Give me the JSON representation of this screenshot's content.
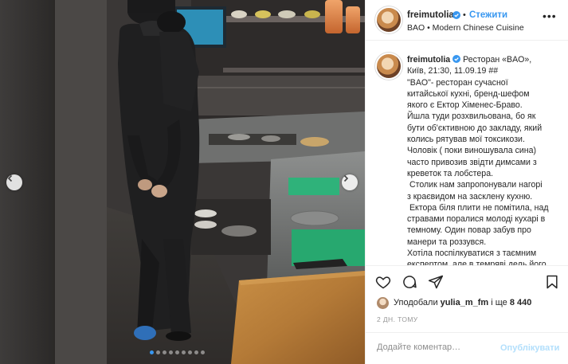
{
  "post": {
    "username": "freimutolia",
    "follow_label": "Стежити",
    "separator": "•",
    "location": "BAO • Modern Chinese Cuisine",
    "more_label": "•••"
  },
  "caption": {
    "username": "freimutolia",
    "lines": [
      "Ресторан «BAO»,",
      "Київ, 21:30, 11.09.19 ##",
      "\"BAO\"- ресторан сучасної",
      "китайської кухні, бренд-шефом",
      "якого є Ектор Хіменес-Браво.",
      "Йшла туди розхвильована, бо як",
      "бути об'єктивною до закладу, який",
      "колись рятував мої токсикози.",
      "Чоловік ( поки виношувала сина)",
      "часто привозив звідти димсами з",
      "креветок та лобстера.",
      " Столик нам запропонували нагорі",
      "з краєвидом на засклену кухню.",
      " Ектора біля плити не помітила, над",
      "стравами поралися молоді кухарі в",
      "темному. Один повар забув про",
      "манери та роззувся.",
      "Хотіла поспілкуватися з таємним",
      "експертом, але в темряві дедь його"
    ]
  },
  "likes": {
    "prefix": "Уподобали",
    "user": "yulia_m_fm",
    "conjunction": "і ще",
    "count": "8 440"
  },
  "timestamp": "2 ДН. ТОМУ",
  "comment": {
    "placeholder": "Додайте коментар…",
    "post_label": "Опублікувати"
  },
  "carousel": {
    "slide_count": 9,
    "active_index": 0
  },
  "icons": {
    "verified": "verified-badge-icon",
    "like": "heart-icon",
    "comment": "comment-bubble-icon",
    "share": "paper-plane-icon",
    "save": "bookmark-icon",
    "prev": "chevron-left-icon",
    "next": "chevron-right-icon"
  },
  "colors": {
    "accent": "#3897f0",
    "post_button_disabled": "#b2dffc",
    "muted": "#8e8e8e"
  }
}
